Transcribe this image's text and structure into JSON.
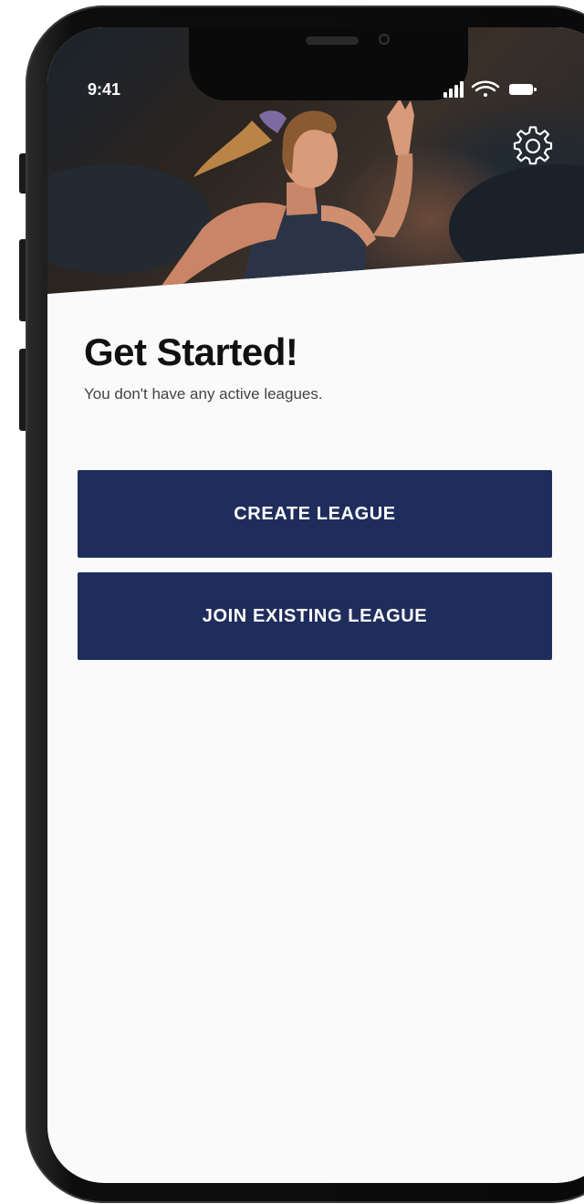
{
  "status_bar": {
    "time": "9:41",
    "icons": [
      "cellular-signal-icon",
      "wifi-icon",
      "battery-icon"
    ]
  },
  "header": {
    "hero_image": "runner-photo",
    "settings_icon": "gear-icon"
  },
  "main": {
    "title": "Get Started!",
    "subtitle": "You don't have any active leagues.",
    "create_button_label": "CREATE LEAGUE",
    "join_button_label": "JOIN EXISTING LEAGUE"
  },
  "colors": {
    "button_background": "#1f2d5c",
    "button_text": "#ffffff",
    "page_background": "#fafafa",
    "title_text": "#111111"
  }
}
